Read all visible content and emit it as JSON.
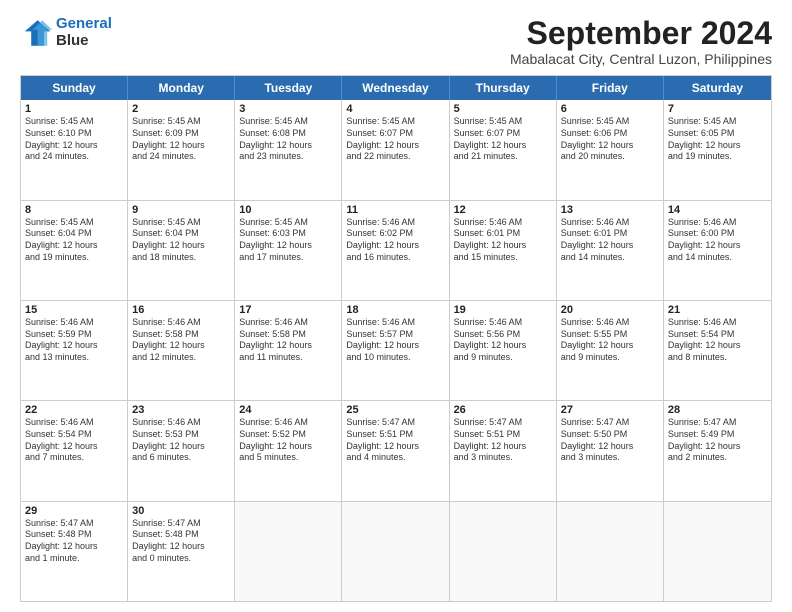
{
  "logo": {
    "line1": "General",
    "line2": "Blue"
  },
  "title": "September 2024",
  "subtitle": "Mabalacat City, Central Luzon, Philippines",
  "days": [
    "Sunday",
    "Monday",
    "Tuesday",
    "Wednesday",
    "Thursday",
    "Friday",
    "Saturday"
  ],
  "rows": [
    [
      {
        "day": "1",
        "text": "Sunrise: 5:45 AM\nSunset: 6:10 PM\nDaylight: 12 hours\nand 24 minutes."
      },
      {
        "day": "2",
        "text": "Sunrise: 5:45 AM\nSunset: 6:09 PM\nDaylight: 12 hours\nand 24 minutes."
      },
      {
        "day": "3",
        "text": "Sunrise: 5:45 AM\nSunset: 6:08 PM\nDaylight: 12 hours\nand 23 minutes."
      },
      {
        "day": "4",
        "text": "Sunrise: 5:45 AM\nSunset: 6:07 PM\nDaylight: 12 hours\nand 22 minutes."
      },
      {
        "day": "5",
        "text": "Sunrise: 5:45 AM\nSunset: 6:07 PM\nDaylight: 12 hours\nand 21 minutes."
      },
      {
        "day": "6",
        "text": "Sunrise: 5:45 AM\nSunset: 6:06 PM\nDaylight: 12 hours\nand 20 minutes."
      },
      {
        "day": "7",
        "text": "Sunrise: 5:45 AM\nSunset: 6:05 PM\nDaylight: 12 hours\nand 19 minutes."
      }
    ],
    [
      {
        "day": "8",
        "text": "Sunrise: 5:45 AM\nSunset: 6:04 PM\nDaylight: 12 hours\nand 19 minutes."
      },
      {
        "day": "9",
        "text": "Sunrise: 5:45 AM\nSunset: 6:04 PM\nDaylight: 12 hours\nand 18 minutes."
      },
      {
        "day": "10",
        "text": "Sunrise: 5:45 AM\nSunset: 6:03 PM\nDaylight: 12 hours\nand 17 minutes."
      },
      {
        "day": "11",
        "text": "Sunrise: 5:46 AM\nSunset: 6:02 PM\nDaylight: 12 hours\nand 16 minutes."
      },
      {
        "day": "12",
        "text": "Sunrise: 5:46 AM\nSunset: 6:01 PM\nDaylight: 12 hours\nand 15 minutes."
      },
      {
        "day": "13",
        "text": "Sunrise: 5:46 AM\nSunset: 6:01 PM\nDaylight: 12 hours\nand 14 minutes."
      },
      {
        "day": "14",
        "text": "Sunrise: 5:46 AM\nSunset: 6:00 PM\nDaylight: 12 hours\nand 14 minutes."
      }
    ],
    [
      {
        "day": "15",
        "text": "Sunrise: 5:46 AM\nSunset: 5:59 PM\nDaylight: 12 hours\nand 13 minutes."
      },
      {
        "day": "16",
        "text": "Sunrise: 5:46 AM\nSunset: 5:58 PM\nDaylight: 12 hours\nand 12 minutes."
      },
      {
        "day": "17",
        "text": "Sunrise: 5:46 AM\nSunset: 5:58 PM\nDaylight: 12 hours\nand 11 minutes."
      },
      {
        "day": "18",
        "text": "Sunrise: 5:46 AM\nSunset: 5:57 PM\nDaylight: 12 hours\nand 10 minutes."
      },
      {
        "day": "19",
        "text": "Sunrise: 5:46 AM\nSunset: 5:56 PM\nDaylight: 12 hours\nand 9 minutes."
      },
      {
        "day": "20",
        "text": "Sunrise: 5:46 AM\nSunset: 5:55 PM\nDaylight: 12 hours\nand 9 minutes."
      },
      {
        "day": "21",
        "text": "Sunrise: 5:46 AM\nSunset: 5:54 PM\nDaylight: 12 hours\nand 8 minutes."
      }
    ],
    [
      {
        "day": "22",
        "text": "Sunrise: 5:46 AM\nSunset: 5:54 PM\nDaylight: 12 hours\nand 7 minutes."
      },
      {
        "day": "23",
        "text": "Sunrise: 5:46 AM\nSunset: 5:53 PM\nDaylight: 12 hours\nand 6 minutes."
      },
      {
        "day": "24",
        "text": "Sunrise: 5:46 AM\nSunset: 5:52 PM\nDaylight: 12 hours\nand 5 minutes."
      },
      {
        "day": "25",
        "text": "Sunrise: 5:47 AM\nSunset: 5:51 PM\nDaylight: 12 hours\nand 4 minutes."
      },
      {
        "day": "26",
        "text": "Sunrise: 5:47 AM\nSunset: 5:51 PM\nDaylight: 12 hours\nand 3 minutes."
      },
      {
        "day": "27",
        "text": "Sunrise: 5:47 AM\nSunset: 5:50 PM\nDaylight: 12 hours\nand 3 minutes."
      },
      {
        "day": "28",
        "text": "Sunrise: 5:47 AM\nSunset: 5:49 PM\nDaylight: 12 hours\nand 2 minutes."
      }
    ],
    [
      {
        "day": "29",
        "text": "Sunrise: 5:47 AM\nSunset: 5:48 PM\nDaylight: 12 hours\nand 1 minute."
      },
      {
        "day": "30",
        "text": "Sunrise: 5:47 AM\nSunset: 5:48 PM\nDaylight: 12 hours\nand 0 minutes."
      },
      {
        "day": "",
        "text": ""
      },
      {
        "day": "",
        "text": ""
      },
      {
        "day": "",
        "text": ""
      },
      {
        "day": "",
        "text": ""
      },
      {
        "day": "",
        "text": ""
      }
    ]
  ]
}
